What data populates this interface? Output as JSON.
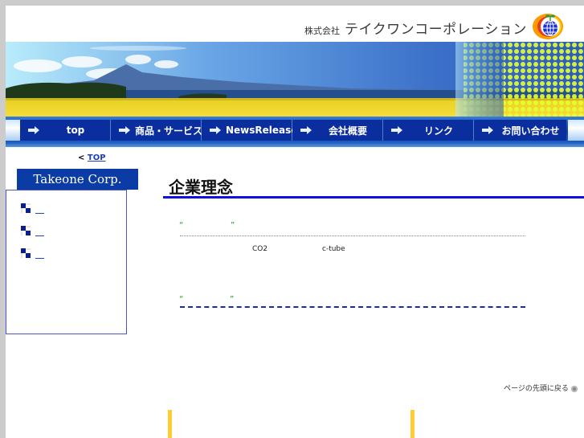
{
  "header": {
    "company_prefix": "株式会社",
    "company_name": "テイクワンコーポレーション",
    "logo": "globe-sprout-logo"
  },
  "banner": {
    "image": "rapeseed-field-mountain-lake-banner"
  },
  "nav": {
    "items": [
      {
        "label": "top",
        "icon": "arrow-right-icon"
      },
      {
        "label": "商品・サービス",
        "icon": "arrow-right-icon"
      },
      {
        "label": "NewsRelease",
        "icon": "arrow-right-icon"
      },
      {
        "label": "会社概要",
        "icon": "arrow-right-icon"
      },
      {
        "label": "リンク",
        "icon": "arrow-right-icon"
      },
      {
        "label": "お問い合わせ",
        "icon": "arrow-right-icon"
      }
    ]
  },
  "sidebar": {
    "back_prefix": "<",
    "back_link": "TOP",
    "corp_title": "Takeone Corp.",
    "items": [
      {
        "label": "",
        "icon": "blue-squares-bullet-icon"
      },
      {
        "label": "",
        "icon": "blue-squares-bullet-icon"
      },
      {
        "label": "",
        "icon": "blue-squares-bullet-icon"
      }
    ]
  },
  "main": {
    "title": "企業理念",
    "section1": {
      "open_quote": "“",
      "close_quote": "”",
      "text_a": "CO2",
      "text_b": "c-tube"
    },
    "section2": {
      "open_quote": "“",
      "close_quote": "”"
    },
    "back_to_top": "ページの先頭に戻る"
  }
}
